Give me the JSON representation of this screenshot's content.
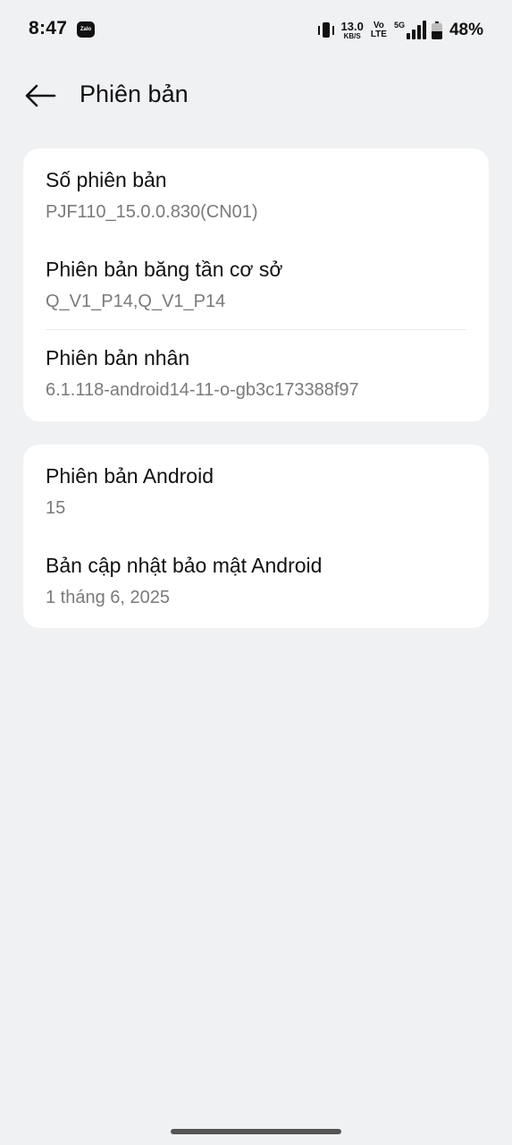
{
  "status_bar": {
    "time": "8:47",
    "zalo_label": "Zalo",
    "net_speed_value": "13.0",
    "net_speed_unit": "KB/S",
    "volte_top": "Vo",
    "volte_bottom": "LTE",
    "network_type": "5G",
    "battery_percent": 48,
    "battery_text": "48%"
  },
  "header": {
    "title": "Phiên bản"
  },
  "card_1": {
    "items": [
      {
        "label": "Số phiên bản",
        "value": "PJF110_15.0.0.830(CN01)"
      },
      {
        "label": "Phiên bản băng tần cơ sở",
        "value": "Q_V1_P14,Q_V1_P14"
      },
      {
        "label": "Phiên bản nhân",
        "value": "6.1.118-android14-11-o-gb3c173388f97"
      }
    ]
  },
  "card_2": {
    "items": [
      {
        "label": "Phiên bản Android",
        "value": "15"
      },
      {
        "label": "Bản cập nhật bảo mật Android",
        "value": "1 tháng 6, 2025"
      }
    ]
  }
}
